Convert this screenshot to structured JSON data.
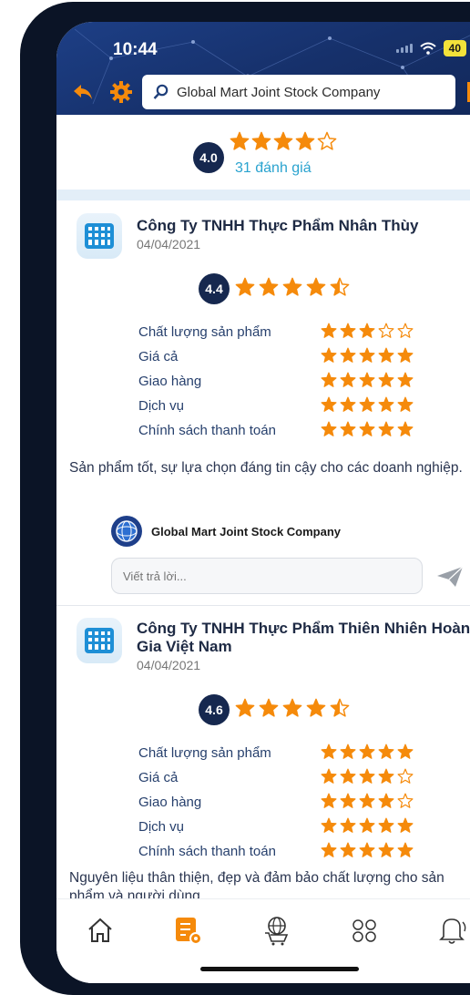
{
  "status_bar": {
    "time": "10:44",
    "battery": "40"
  },
  "header": {
    "search_value": "Global Mart Joint Stock Company"
  },
  "summary": {
    "rating": "4.0",
    "stars": 4,
    "reviews_text": "31 đánh giá"
  },
  "reviews": [
    {
      "company": "Công Ty TNHH Thực Phẩm Nhân Thùy",
      "date": "04/04/2021",
      "rating": "4.4",
      "stars": 4.5,
      "criteria": [
        {
          "label": "Chất lượng sản phẩm",
          "stars": 3
        },
        {
          "label": "Giá cả",
          "stars": 5
        },
        {
          "label": "Giao hàng",
          "stars": 5
        },
        {
          "label": "Dịch vụ",
          "stars": 5
        },
        {
          "label": "Chính sách thanh toán",
          "stars": 5
        }
      ],
      "comment": "Sản phẩm tốt, sự lựa chọn đáng tin cậy cho các doanh nghiệp.",
      "replyer": "Global Mart Joint Stock Company",
      "reply_placeholder": "Viết trả lời..."
    },
    {
      "company": "Công Ty TNHH Thực Phẩm Thiên Nhiên Hoàng Gia Việt Nam",
      "date": "04/04/2021",
      "rating": "4.6",
      "stars": 4.5,
      "criteria": [
        {
          "label": "Chất lượng sản phẩm",
          "stars": 5
        },
        {
          "label": "Giá cả",
          "stars": 4
        },
        {
          "label": "Giao hàng",
          "stars": 4
        },
        {
          "label": "Dịch vụ",
          "stars": 5
        },
        {
          "label": "Chính sách thanh toán",
          "stars": 5
        }
      ],
      "comment": "Nguyên liệu thân thiện, đẹp và đảm bảo chất lượng cho sản phẩm và người dùng."
    }
  ],
  "tabbar": {
    "items": [
      {
        "icon": "home-icon",
        "active": false
      },
      {
        "icon": "checklist-settings-icon",
        "active": true
      },
      {
        "icon": "global-cart-icon",
        "active": false
      },
      {
        "icon": "users-group-icon",
        "active": false
      },
      {
        "icon": "notification-bell-icon",
        "active": false
      }
    ]
  },
  "colors": {
    "header": "#1a3670",
    "star": "#f58a0b",
    "link": "#2aa3cf",
    "badge": "#16284f",
    "tab_active": "#f58a0b"
  }
}
